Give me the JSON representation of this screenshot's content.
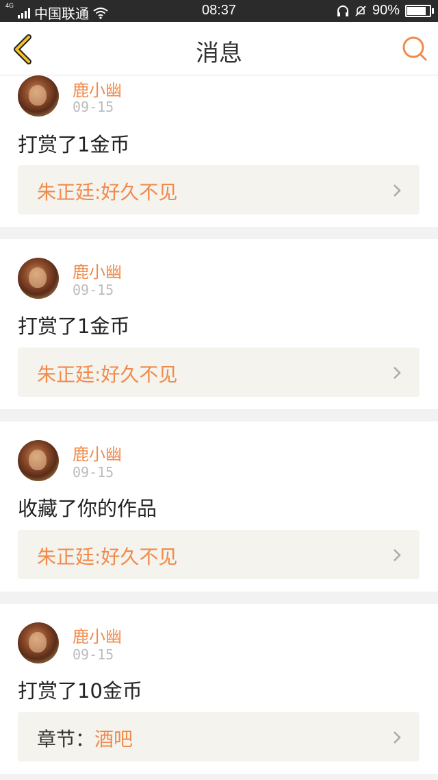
{
  "status_bar": {
    "network_type": "4G",
    "carrier": "中国联通",
    "time": "08:37",
    "battery": "90%",
    "battery_level": 0.9,
    "icons": [
      "signal-icon",
      "wifi-icon",
      "headset-icon",
      "mute-bell-icon",
      "battery-icon"
    ]
  },
  "header": {
    "title": "消息",
    "back_icon": "chevron-left-icon",
    "search_icon": "search-icon"
  },
  "colors": {
    "accent": "#f08a4b",
    "back_icon": "#f2c230",
    "card_link_bg": "#f4f3ee",
    "page_bg": "#f2f2f2"
  },
  "messages": [
    {
      "username": "鹿小幽",
      "date": "09-15",
      "action": "打赏了1金币",
      "link_prefix": "",
      "link_text": "朱正廷:好久不见"
    },
    {
      "username": "鹿小幽",
      "date": "09-15",
      "action": "打赏了1金币",
      "link_prefix": "",
      "link_text": "朱正廷:好久不见"
    },
    {
      "username": "鹿小幽",
      "date": "09-15",
      "action": "收藏了你的作品",
      "link_prefix": "",
      "link_text": "朱正廷:好久不见"
    },
    {
      "username": "鹿小幽",
      "date": "09-15",
      "action": "打赏了10金币",
      "link_prefix": "章节：",
      "link_text": "酒吧"
    }
  ]
}
